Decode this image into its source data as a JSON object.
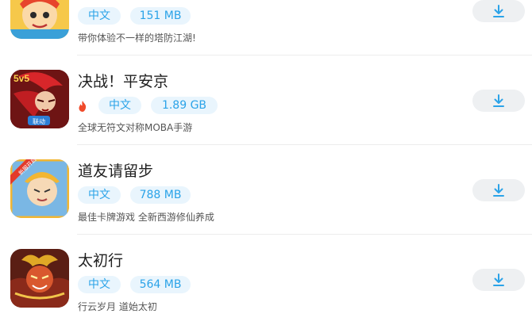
{
  "apps": [
    {
      "name": "",
      "hot": false,
      "language": "中文",
      "size": "151 MB",
      "description": "带你体验不一样的塔防江湖!",
      "icon": "cartoon-monkey-king-icon"
    },
    {
      "name": "决战！平安京",
      "hot": true,
      "language": "中文",
      "size": "1.89 GB",
      "description": "全球无符文对称MOBA手游",
      "icon": "red-hair-warrior-icon",
      "icon_text": {
        "top": "5v5",
        "bottom": "联动"
      }
    },
    {
      "name": "道友请留步",
      "hot": false,
      "language": "中文",
      "size": "788 MB",
      "description": "最佳卡牌游戏 全新西游修仙养成",
      "icon": "golden-immortal-icon",
      "icon_text": {
        "ribbon": "新服开启"
      }
    },
    {
      "name": "太初行",
      "hot": false,
      "language": "中文",
      "size": "564 MB",
      "description": "行云岁月 道始太初",
      "icon": "demon-warrior-icon"
    }
  ],
  "colors": {
    "badge_text": "#2ba3e8",
    "badge_bg": "#e9f5fd",
    "download_arrow": "#2ba3e8",
    "download_bg": "#eef0f2",
    "hot": "#f04a2a"
  }
}
